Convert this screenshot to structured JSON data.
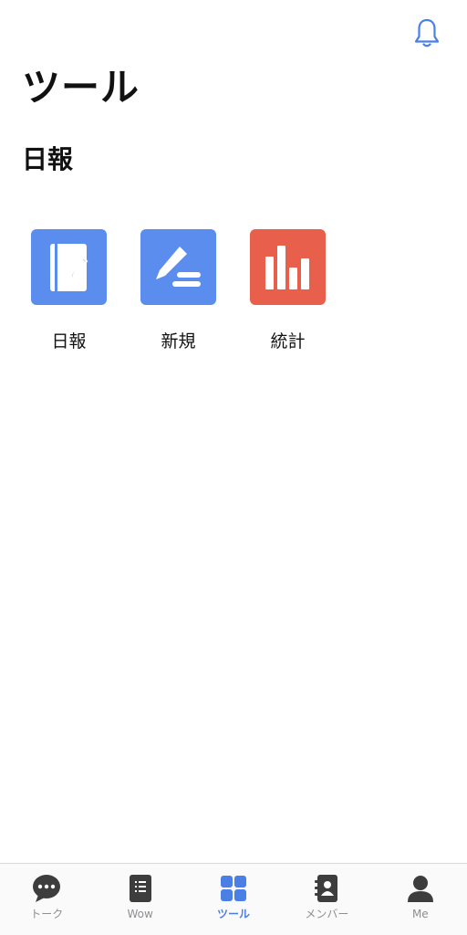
{
  "header": {
    "title": "ツール",
    "section": "日報",
    "notification_icon": "bell-icon"
  },
  "tools": [
    {
      "label": "日報",
      "icon": "notebook-icon",
      "color": "#5b8def"
    },
    {
      "label": "新規",
      "icon": "pencil-icon",
      "color": "#5b8def"
    },
    {
      "label": "統計",
      "icon": "bar-chart-icon",
      "color": "#e8604c"
    }
  ],
  "tabbar": {
    "active_color": "#4a7fe6",
    "inactive_color": "#8e8e93",
    "items": [
      {
        "label": "トーク",
        "icon": "chat-bubble-icon",
        "active": false
      },
      {
        "label": "Wow",
        "icon": "list-card-icon",
        "active": false
      },
      {
        "label": "ツール",
        "icon": "grid-icon",
        "active": true
      },
      {
        "label": "メンバー",
        "icon": "contacts-icon",
        "active": false
      },
      {
        "label": "Me",
        "icon": "person-icon",
        "active": false
      }
    ]
  }
}
